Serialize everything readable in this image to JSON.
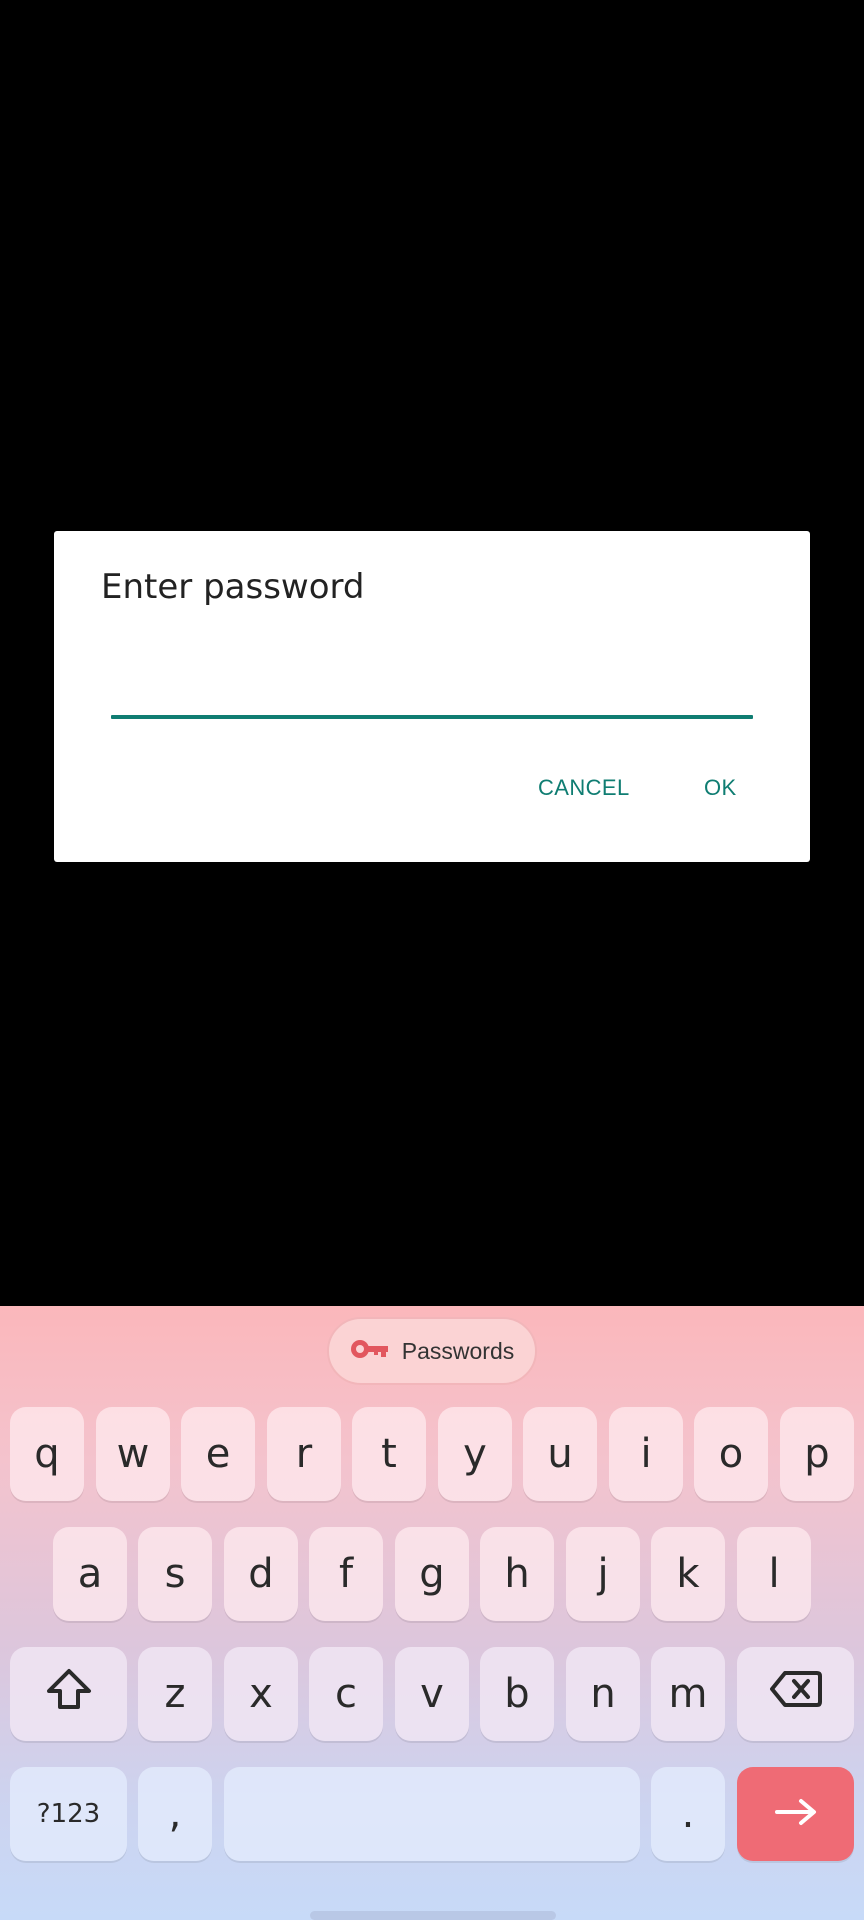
{
  "dialog": {
    "title": "Enter password",
    "password_value": "",
    "cancel_label": "CANCEL",
    "ok_label": "OK"
  },
  "keyboard": {
    "suggestion": {
      "icon": "key-icon",
      "label": "Passwords"
    },
    "row1": [
      "q",
      "w",
      "e",
      "r",
      "t",
      "y",
      "u",
      "i",
      "o",
      "p"
    ],
    "row2": [
      "a",
      "s",
      "d",
      "f",
      "g",
      "h",
      "j",
      "k",
      "l"
    ],
    "row3": [
      "z",
      "x",
      "c",
      "v",
      "b",
      "n",
      "m"
    ],
    "symbols_label": "?123",
    "comma_label": ",",
    "period_label": ".",
    "shift_icon": "shift-icon",
    "backspace_icon": "backspace-icon",
    "enter_icon": "arrow-right-icon"
  },
  "colors": {
    "accent": "#0f7d72",
    "enter_key": "#ef6b75",
    "key_icon": "#e2565e"
  }
}
